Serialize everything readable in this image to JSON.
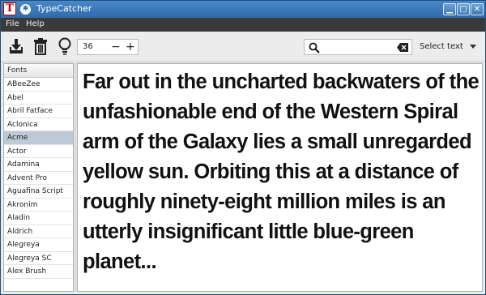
{
  "window": {
    "title": "TypeCatcher"
  },
  "menu": {
    "file": "File",
    "help": "Help"
  },
  "toolbar": {
    "font_size": "36",
    "minus": "−",
    "plus": "+",
    "select_text_label": "Select text"
  },
  "fontlist": {
    "header": "Fonts",
    "items": [
      "ABeeZee",
      "Abel",
      "Abril Fatface",
      "Aclonica",
      "Acme",
      "Actor",
      "Adamina",
      "Advent Pro",
      "Aguafina Script",
      "Akronim",
      "Aladin",
      "Aldrich",
      "Alegreya",
      "Alegreya SC",
      "Alex Brush"
    ],
    "selected": "Acme"
  },
  "preview": {
    "text": "Far out in the uncharted backwaters of the unfashionable end of the Western Spiral arm of the Galaxy lies a small unregarded yellow sun. Orbiting this at a distance of roughly ninety-eight million miles is an utterly insignificant little blue-green planet..."
  },
  "colors": {
    "titlebar": "#2f6bab",
    "menubar": "#3a3a3a",
    "selection": "#bdc9d6"
  }
}
